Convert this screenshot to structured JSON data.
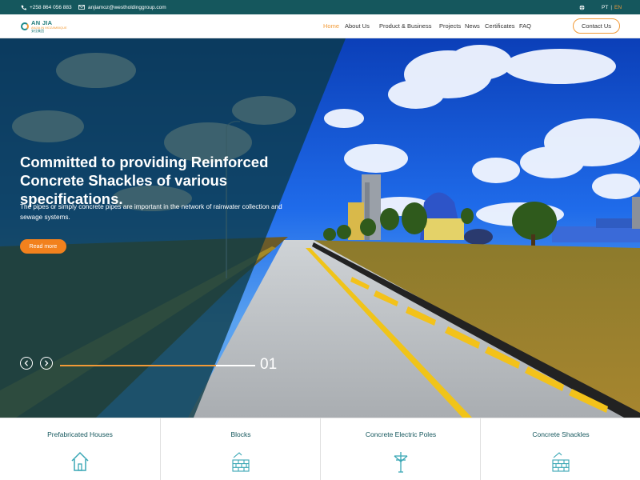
{
  "topbar": {
    "phone": "+258 864 056 883",
    "email": "anjiamoz@westholdinggroup.com",
    "lang_pt": "PT",
    "lang_separator": "|",
    "lang_en": "EN"
  },
  "logo": {
    "main": "AN JIA",
    "sub": "ANJIA IN MOZAMBIQUE",
    "sub2": "安佳集团"
  },
  "nav": {
    "items": [
      {
        "label": "Home",
        "active": true
      },
      {
        "label": "About Us"
      },
      {
        "label": "Product & Business"
      },
      {
        "label": "Projects"
      },
      {
        "label": "News"
      },
      {
        "label": "Certificates"
      },
      {
        "label": "FAQ"
      }
    ],
    "contact_label": "Contact Us"
  },
  "hero": {
    "title": "Committed to providing Reinforced Concrete Shackles of various specifications.",
    "description": "The pipes or simply concrete pipes are important in the network of rainwater collection and sewage systems.",
    "button_label": "Read more",
    "slide_number": "01",
    "progress": 0.8
  },
  "cards": [
    {
      "label": "Prefabricated Houses",
      "icon": "house-icon"
    },
    {
      "label": "Blocks",
      "icon": "blocks-icon"
    },
    {
      "label": "Concrete Electric Poles",
      "icon": "electric-pole-icon"
    },
    {
      "label": "Concrete Shackles",
      "icon": "shackles-icon"
    }
  ],
  "colors": {
    "topbar": "#15575d",
    "accent": "#f29a36",
    "button": "#f2811d",
    "teal": "#1d8a8a"
  }
}
